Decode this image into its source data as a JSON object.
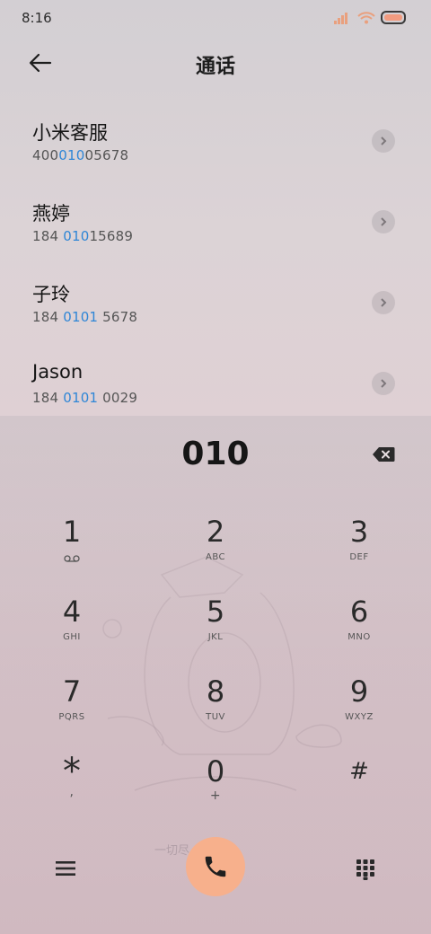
{
  "status_bar": {
    "time": "8:16"
  },
  "header": {
    "title": "通话"
  },
  "contacts": [
    {
      "name": "小米客服",
      "number_prefix": "400",
      "number_match": "010",
      "number_suffix": "05678"
    },
    {
      "name": "燕婷",
      "number_prefix": "184 ",
      "number_match": "010",
      "number_suffix": "15689"
    },
    {
      "name": "子玲",
      "number_prefix": "184 ",
      "number_match": "0101",
      "number_suffix": " 5678"
    },
    {
      "name": "Jason",
      "number_prefix": "184 ",
      "number_match": "0101",
      "number_suffix": " 0029"
    }
  ],
  "dialer": {
    "input": "010",
    "keys": [
      {
        "digit": "1",
        "letters": ""
      },
      {
        "digit": "2",
        "letters": "ABC"
      },
      {
        "digit": "3",
        "letters": "DEF"
      },
      {
        "digit": "4",
        "letters": "GHI"
      },
      {
        "digit": "5",
        "letters": "JKL"
      },
      {
        "digit": "6",
        "letters": "MNO"
      },
      {
        "digit": "7",
        "letters": "PQRS"
      },
      {
        "digit": "8",
        "letters": "TUV"
      },
      {
        "digit": "9",
        "letters": "WXYZ"
      },
      {
        "digit": "*",
        "letters": ","
      },
      {
        "digit": "0",
        "letters": "+"
      },
      {
        "digit": "#",
        "letters": ""
      }
    ]
  },
  "icons": {
    "back": "arrow-left-icon",
    "chevron": "chevron-right-icon",
    "backspace": "backspace-icon",
    "voicemail": "voicemail-icon",
    "menu": "menu-icon",
    "call": "phone-icon",
    "keypad": "keypad-icon"
  },
  "colors": {
    "match_highlight": "#2f86d6",
    "call_button": "#f7b08c",
    "battery": "#f19b80"
  }
}
